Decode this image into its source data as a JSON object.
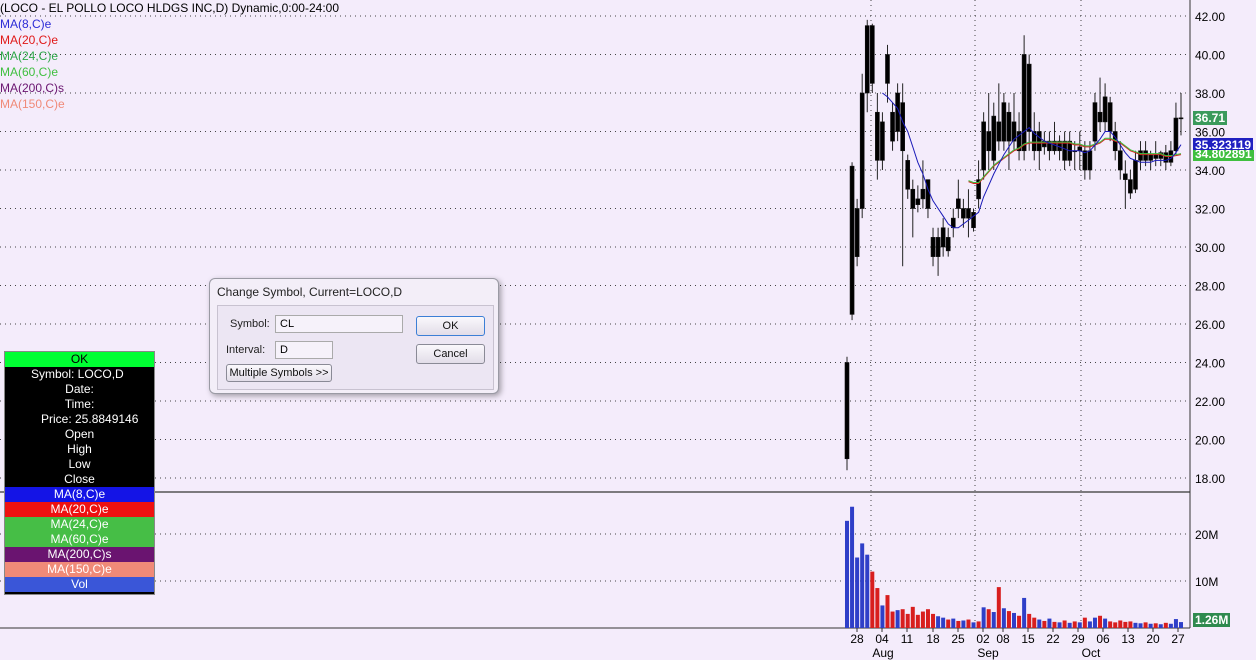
{
  "chart": {
    "title": "(LOCO - EL POLLO LOCO HLDGS INC,D) Dynamic,0:00-24:00",
    "studies": [
      {
        "label": "MA(8,C)e",
        "color": "#2b2bd6"
      },
      {
        "label": "MA(20,C)e",
        "color": "#e01818"
      },
      {
        "label": "MA(24,C)e",
        "color": "#2fa84a"
      },
      {
        "label": "MA(60,C)e",
        "color": "#3fbf3f"
      },
      {
        "label": "MA(200,C)s",
        "color": "#6a1470"
      },
      {
        "label": "MA(150,C)e",
        "color": "#f08a78"
      }
    ],
    "price_axis": [
      "42.00",
      "40.00",
      "38.00",
      "36.00",
      "34.00",
      "32.00",
      "30.00",
      "28.00",
      "26.00",
      "24.00",
      "22.00",
      "20.00",
      "18.00"
    ],
    "volume_axis": [
      "20M",
      "10M"
    ],
    "price_tags": [
      {
        "text": "36.71",
        "bg": "#3b9a5c"
      },
      {
        "text": "35.323119",
        "bg": "#2020c0"
      },
      {
        "text": "34.802891",
        "bg": "#3fbf3f"
      }
    ],
    "volume_tag": {
      "text": "1.26M",
      "bg": "#2f8a4f"
    },
    "date_ticks": [
      "28",
      "04",
      "11",
      "18",
      "25",
      "02",
      "08",
      "15",
      "22",
      "29",
      "06",
      "13",
      "20",
      "27"
    ],
    "month_labels": [
      "Aug",
      "Sep",
      "Oct"
    ]
  },
  "chart_data": {
    "type": "candlestick",
    "y_range": [
      17.5,
      43
    ],
    "volume_range_millions": [
      0,
      25
    ],
    "candles": [
      {
        "o": 19.0,
        "h": 24.3,
        "l": 18.4,
        "c": 24.0,
        "v": 22.8,
        "up": true
      },
      {
        "o": 26.5,
        "h": 34.4,
        "l": 26.2,
        "c": 34.2,
        "v": 25.8,
        "up": true
      },
      {
        "o": 29.5,
        "h": 32.5,
        "l": 29.0,
        "c": 32.0,
        "v": 15.0,
        "up": true
      },
      {
        "o": 32.0,
        "h": 39.0,
        "l": 31.5,
        "c": 38.0,
        "v": 18.0,
        "up": true
      },
      {
        "o": 38.0,
        "h": 41.8,
        "l": 37.0,
        "c": 41.5,
        "v": 15.6,
        "up": true
      },
      {
        "o": 41.5,
        "h": 41.6,
        "l": 38.0,
        "c": 38.5,
        "v": 12.0,
        "up": false
      },
      {
        "o": 37.0,
        "h": 38.0,
        "l": 33.5,
        "c": 34.5,
        "v": 8.5,
        "up": false
      },
      {
        "o": 34.5,
        "h": 37.0,
        "l": 34.0,
        "c": 36.5,
        "v": 4.8,
        "up": true
      },
      {
        "o": 40.0,
        "h": 40.5,
        "l": 37.5,
        "c": 38.5,
        "v": 7.0,
        "up": false
      },
      {
        "o": 37.0,
        "h": 37.5,
        "l": 35.0,
        "c": 35.5,
        "v": 3.5,
        "up": false
      },
      {
        "o": 36.0,
        "h": 38.5,
        "l": 35.5,
        "c": 38.0,
        "v": 3.8,
        "up": true
      },
      {
        "o": 37.5,
        "h": 38.5,
        "l": 29.0,
        "c": 35.0,
        "v": 4.0,
        "up": false
      },
      {
        "o": 34.5,
        "h": 34.8,
        "l": 32.5,
        "c": 33.0,
        "v": 3.0,
        "up": false
      },
      {
        "o": 33.0,
        "h": 33.5,
        "l": 30.5,
        "c": 32.0,
        "v": 4.5,
        "up": false
      },
      {
        "o": 32.5,
        "h": 33.2,
        "l": 31.8,
        "c": 32.2,
        "v": 2.8,
        "up": false
      },
      {
        "o": 32.5,
        "h": 34.5,
        "l": 32.0,
        "c": 33.0,
        "v": 3.5,
        "up": false
      },
      {
        "o": 33.5,
        "h": 33.5,
        "l": 31.5,
        "c": 32.0,
        "v": 4.0,
        "up": false
      },
      {
        "o": 30.5,
        "h": 31.0,
        "l": 29.0,
        "c": 29.5,
        "v": 3.0,
        "up": false
      },
      {
        "o": 29.5,
        "h": 31.0,
        "l": 28.5,
        "c": 30.5,
        "v": 2.5,
        "up": true
      },
      {
        "o": 30.0,
        "h": 31.5,
        "l": 29.5,
        "c": 31.0,
        "v": 2.2,
        "up": true
      },
      {
        "o": 30.5,
        "h": 31.0,
        "l": 29.5,
        "c": 29.8,
        "v": 1.8,
        "up": false
      },
      {
        "o": 31.0,
        "h": 32.0,
        "l": 30.5,
        "c": 31.5,
        "v": 2.0,
        "up": true
      },
      {
        "o": 32.0,
        "h": 33.5,
        "l": 31.5,
        "c": 32.5,
        "v": 1.5,
        "up": false
      },
      {
        "o": 31.5,
        "h": 32.5,
        "l": 31.0,
        "c": 32.0,
        "v": 1.6,
        "up": true
      },
      {
        "o": 32.0,
        "h": 33.0,
        "l": 30.5,
        "c": 31.5,
        "v": 1.8,
        "up": false
      },
      {
        "o": 31.0,
        "h": 32.0,
        "l": 30.8,
        "c": 31.8,
        "v": 1.2,
        "up": true
      },
      {
        "o": 32.5,
        "h": 34.5,
        "l": 32.0,
        "c": 33.5,
        "v": 1.4,
        "up": false
      },
      {
        "o": 34.0,
        "h": 37.0,
        "l": 33.5,
        "c": 36.5,
        "v": 4.4,
        "up": true
      },
      {
        "o": 36.0,
        "h": 38.0,
        "l": 34.0,
        "c": 35.0,
        "v": 4.0,
        "up": false
      },
      {
        "o": 34.5,
        "h": 37.5,
        "l": 34.0,
        "c": 36.8,
        "v": 3.4,
        "up": true
      },
      {
        "o": 36.5,
        "h": 38.5,
        "l": 35.0,
        "c": 35.5,
        "v": 8.7,
        "up": false
      },
      {
        "o": 35.5,
        "h": 38.0,
        "l": 35.0,
        "c": 37.5,
        "v": 4.2,
        "up": true
      },
      {
        "o": 37.0,
        "h": 37.5,
        "l": 34.0,
        "c": 35.5,
        "v": 3.6,
        "up": false
      },
      {
        "o": 35.5,
        "h": 38.0,
        "l": 35.0,
        "c": 36.5,
        "v": 3.2,
        "up": true
      },
      {
        "o": 36.0,
        "h": 37.0,
        "l": 34.5,
        "c": 35.0,
        "v": 2.6,
        "up": false
      },
      {
        "o": 35.0,
        "h": 41.0,
        "l": 34.5,
        "c": 40.0,
        "v": 6.4,
        "up": true
      },
      {
        "o": 39.5,
        "h": 40.0,
        "l": 35.0,
        "c": 36.0,
        "v": 3.0,
        "up": false
      },
      {
        "o": 36.0,
        "h": 37.0,
        "l": 34.5,
        "c": 35.0,
        "v": 2.2,
        "up": false
      },
      {
        "o": 35.0,
        "h": 36.5,
        "l": 34.0,
        "c": 36.0,
        "v": 1.8,
        "up": true
      },
      {
        "o": 35.5,
        "h": 36.0,
        "l": 34.8,
        "c": 35.2,
        "v": 1.5,
        "up": false
      },
      {
        "o": 35.0,
        "h": 36.0,
        "l": 34.5,
        "c": 35.5,
        "v": 2.0,
        "up": true
      },
      {
        "o": 35.5,
        "h": 36.5,
        "l": 34.8,
        "c": 35.0,
        "v": 1.3,
        "up": false
      },
      {
        "o": 35.0,
        "h": 35.8,
        "l": 34.5,
        "c": 35.5,
        "v": 1.2,
        "up": true
      },
      {
        "o": 35.5,
        "h": 36.0,
        "l": 34.0,
        "c": 34.5,
        "v": 1.6,
        "up": false
      },
      {
        "o": 34.5,
        "h": 36.0,
        "l": 34.2,
        "c": 35.5,
        "v": 1.1,
        "up": true
      },
      {
        "o": 35.0,
        "h": 35.5,
        "l": 34.0,
        "c": 35.0,
        "v": 1.4,
        "up": false
      },
      {
        "o": 35.0,
        "h": 36.0,
        "l": 34.0,
        "c": 35.2,
        "v": 1.2,
        "up": true
      },
      {
        "o": 35.0,
        "h": 35.5,
        "l": 33.5,
        "c": 34.0,
        "v": 2.2,
        "up": false
      },
      {
        "o": 34.0,
        "h": 35.5,
        "l": 33.5,
        "c": 35.0,
        "v": 1.4,
        "up": true
      },
      {
        "o": 35.5,
        "h": 38.0,
        "l": 35.0,
        "c": 37.5,
        "v": 2.2,
        "up": true
      },
      {
        "o": 37.0,
        "h": 38.8,
        "l": 36.0,
        "c": 36.5,
        "v": 2.6,
        "up": false
      },
      {
        "o": 36.5,
        "h": 38.5,
        "l": 36.0,
        "c": 37.8,
        "v": 2.0,
        "up": true
      },
      {
        "o": 37.5,
        "h": 37.8,
        "l": 35.5,
        "c": 36.0,
        "v": 1.4,
        "up": false
      },
      {
        "o": 36.0,
        "h": 36.5,
        "l": 34.5,
        "c": 35.0,
        "v": 1.2,
        "up": false
      },
      {
        "o": 35.0,
        "h": 35.5,
        "l": 33.5,
        "c": 34.0,
        "v": 1.6,
        "up": false
      },
      {
        "o": 33.8,
        "h": 34.5,
        "l": 32.0,
        "c": 33.5,
        "v": 1.3,
        "up": false
      },
      {
        "o": 33.5,
        "h": 34.0,
        "l": 32.5,
        "c": 32.8,
        "v": 1.4,
        "up": false
      },
      {
        "o": 33.0,
        "h": 35.0,
        "l": 32.8,
        "c": 34.5,
        "v": 1.1,
        "up": true
      },
      {
        "o": 34.5,
        "h": 35.5,
        "l": 34.0,
        "c": 35.0,
        "v": 1.0,
        "up": true
      },
      {
        "o": 35.0,
        "h": 35.5,
        "l": 34.2,
        "c": 34.5,
        "v": 1.2,
        "up": false
      },
      {
        "o": 34.5,
        "h": 35.0,
        "l": 34.0,
        "c": 34.8,
        "v": 0.9,
        "up": true
      },
      {
        "o": 34.8,
        "h": 35.5,
        "l": 34.2,
        "c": 34.6,
        "v": 1.0,
        "up": false
      },
      {
        "o": 34.6,
        "h": 35.0,
        "l": 34.2,
        "c": 34.9,
        "v": 0.8,
        "up": true
      },
      {
        "o": 34.9,
        "h": 35.3,
        "l": 34.0,
        "c": 34.4,
        "v": 1.1,
        "up": false
      },
      {
        "o": 34.4,
        "h": 35.5,
        "l": 34.2,
        "c": 35.0,
        "v": 0.9,
        "up": true
      },
      {
        "o": 35.0,
        "h": 37.5,
        "l": 34.8,
        "c": 36.7,
        "v": 1.9,
        "up": true
      },
      {
        "o": 36.7,
        "h": 38.0,
        "l": 35.8,
        "c": 36.71,
        "v": 1.26,
        "up": true
      }
    ],
    "ma_fast": [
      null,
      null,
      null,
      null,
      null,
      null,
      null,
      38.0,
      37.8,
      37.5,
      37.2,
      36.5,
      36.0,
      35.2,
      34.4,
      33.8,
      33.0,
      32.4,
      32.0,
      31.6,
      31.2,
      31.0,
      31.0,
      31.2,
      31.4,
      31.6,
      31.8,
      32.6,
      33.2,
      33.8,
      34.3,
      34.8,
      35.2,
      35.6,
      35.8,
      36.0,
      36.2,
      35.9,
      35.7,
      35.5,
      35.4,
      35.3,
      35.2,
      35.1,
      35.0,
      35.0,
      35.0,
      34.9,
      35.0,
      35.3,
      35.6,
      36.0,
      36.0,
      35.7,
      35.3,
      34.9,
      34.6,
      34.5,
      34.4,
      34.4,
      34.4,
      34.5,
      34.5,
      34.5,
      34.6,
      34.9,
      35.32
    ],
    "ma_slow": [
      null,
      null,
      null,
      null,
      null,
      null,
      null,
      null,
      null,
      null,
      null,
      null,
      null,
      null,
      null,
      null,
      null,
      null,
      null,
      null,
      null,
      null,
      null,
      null,
      33.4,
      33.3,
      33.3,
      33.6,
      33.9,
      34.2,
      34.4,
      34.6,
      34.8,
      35.0,
      35.1,
      35.3,
      35.4,
      35.4,
      35.4,
      35.4,
      35.4,
      35.4,
      35.4,
      35.4,
      35.4,
      35.3,
      35.3,
      35.2,
      35.2,
      35.3,
      35.4,
      35.6,
      35.6,
      35.5,
      35.4,
      35.2,
      35.0,
      34.9,
      34.8,
      34.8,
      34.8,
      34.8,
      34.8,
      34.7,
      34.7,
      34.75,
      34.8
    ]
  },
  "data_window": {
    "ok_label": "OK",
    "rows": [
      {
        "text": "Symbol: LOCO,D",
        "bg": "#000000",
        "fg": "#ffffff"
      },
      {
        "text": "Date:",
        "bg": "#000000",
        "fg": "#ffffff"
      },
      {
        "text": "Time:",
        "bg": "#000000",
        "fg": "#ffffff"
      },
      {
        "text": "Price: 25.8849146",
        "bg": "#000000",
        "fg": "#ffffff"
      },
      {
        "text": "Open",
        "bg": "#000000",
        "fg": "#ffffff"
      },
      {
        "text": "High",
        "bg": "#000000",
        "fg": "#ffffff"
      },
      {
        "text": "Low",
        "bg": "#000000",
        "fg": "#ffffff"
      },
      {
        "text": "Close",
        "bg": "#000000",
        "fg": "#ffffff"
      },
      {
        "text": "MA(8,C)e",
        "bg": "#1414e6",
        "fg": "#ffffff"
      },
      {
        "text": "MA(20,C)e",
        "bg": "#ee1111",
        "fg": "#ffffff"
      },
      {
        "text": "MA(24,C)e",
        "bg": "#46be46",
        "fg": "#ffffff"
      },
      {
        "text": "MA(60,C)e",
        "bg": "#46be46",
        "fg": "#ffffff"
      },
      {
        "text": "MA(200,C)s",
        "bg": "#6a1470",
        "fg": "#ffffff"
      },
      {
        "text": "MA(150,C)e",
        "bg": "#f08a78",
        "fg": "#ffffff"
      },
      {
        "text": "Vol",
        "bg": "#3a56d8",
        "fg": "#ffffff"
      }
    ]
  },
  "dialog": {
    "title": "Change Symbol, Current=LOCO,D",
    "symbol_label": "Symbol:",
    "symbol_value": "CL",
    "interval_label": "Interval:",
    "interval_value": "D",
    "multiple_symbols_label": "Multiple Symbols >>",
    "ok_label": "OK",
    "cancel_label": "Cancel"
  },
  "colors": {
    "background": "#f4ecfb",
    "up_candle": "#2f3fc8",
    "down_candle": "#d81e1e",
    "grid": "#444444"
  }
}
